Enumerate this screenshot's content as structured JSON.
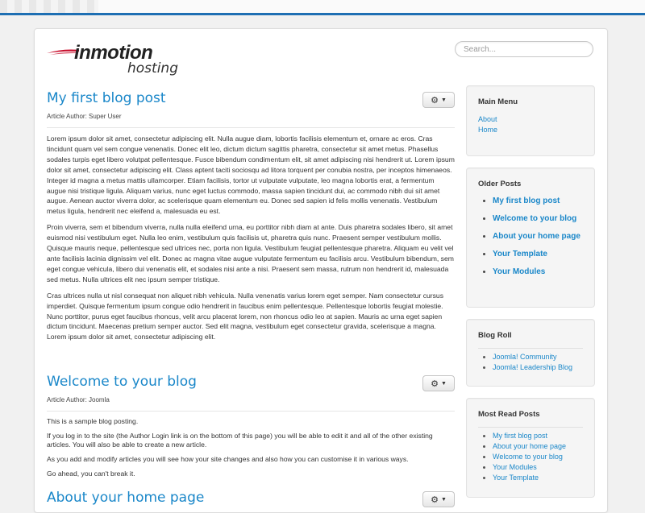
{
  "header": {
    "logo_primary": "inmotion",
    "logo_secondary": "hosting",
    "search_placeholder": "Search..."
  },
  "articles": [
    {
      "title": "My first blog post",
      "author": "Article Author: Super User",
      "paragraphs": [
        "Lorem ipsum dolor sit amet, consectetur adipiscing elit. Nulla augue diam, lobortis facilisis elementum et, ornare ac eros. Cras tincidunt quam vel sem congue venenatis. Donec elit leo, dictum dictum sagittis pharetra, consectetur sit amet metus. Phasellus sodales turpis eget libero volutpat pellentesque. Fusce bibendum condimentum elit, sit amet adipiscing nisi hendrerit ut. Lorem ipsum dolor sit amet, consectetur adipiscing elit. Class aptent taciti sociosqu ad litora torquent per conubia nostra, per inceptos himenaeos. Integer id magna a metus mattis ullamcorper. Etiam facilisis, tortor ut vulputate vulputate, leo magna lobortis erat, a fermentum augue nisi tristique ligula. Aliquam varius, nunc eget luctus commodo, massa sapien tincidunt dui, ac commodo nibh dui sit amet augue. Aenean auctor viverra dolor, ac scelerisque quam elementum eu. Donec sed sapien id felis mollis venenatis. Vestibulum metus ligula, hendrerit nec eleifend a, malesuada eu est.",
        "Proin viverra, sem et bibendum viverra, nulla nulla eleifend urna, eu porttitor nibh diam at ante. Duis pharetra sodales libero, sit amet euismod nisi vestibulum eget. Nulla leo enim, vestibulum quis facilisis ut, pharetra quis nunc. Praesent semper vestibulum mollis. Quisque mauris neque, pellentesque sed ultrices nec, porta non ligula. Vestibulum feugiat pellentesque pharetra. Aliquam eu velit vel ante facilisis lacinia dignissim vel elit. Donec ac magna vitae augue vulputate fermentum eu facilisis arcu. Vestibulum bibendum, sem eget congue vehicula, libero dui venenatis elit, et sodales nisi ante a nisi. Praesent sem massa, rutrum non hendrerit id, malesuada sed metus. Nulla ultrices elit nec ipsum semper tristique.",
        "Cras ultrices nulla ut nisl consequat non aliquet nibh vehicula. Nulla venenatis varius lorem eget semper. Nam consectetur cursus imperdiet. Quisque fermentum ipsum congue odio hendrerit in faucibus enim pellentesque. Pellentesque lobortis feugiat molestie. Nunc porttitor, purus eget faucibus rhoncus, velit arcu placerat lorem, non rhoncus odio leo at sapien. Mauris ac urna eget sapien dictum tincidunt. Maecenas pretium semper auctor. Sed elit magna, vestibulum eget consectetur gravida, scelerisque a magna. Lorem ipsum dolor sit amet, consectetur adipiscing elit."
      ]
    },
    {
      "title": "Welcome to your blog",
      "author": "Article Author: Joomla",
      "paragraphs": [
        "This is a sample blog posting.",
        "If you log in to the site (the Author Login link is on the bottom of this page) you will be able to edit it and all of the other existing articles. You will also be able to create a new article.",
        "As you add and modify articles you will see how your site changes and also how you can customise it in various ways.",
        "Go ahead, you can't break it."
      ]
    },
    {
      "title": "About your home page"
    }
  ],
  "sidebar": {
    "main_menu": {
      "title": "Main Menu",
      "items": [
        "About",
        "Home"
      ]
    },
    "older_posts": {
      "title": "Older Posts",
      "items": [
        "My first blog post",
        "Welcome to your blog",
        "About your home page",
        "Your Template",
        "Your Modules"
      ]
    },
    "blog_roll": {
      "title": "Blog Roll",
      "items": [
        "Joomla! Community",
        "Joomla! Leadership Blog"
      ]
    },
    "most_read": {
      "title": "Most Read Posts",
      "items": [
        "My first blog post",
        "About your home page",
        "Welcome to your blog",
        "Your Modules",
        "Your Template"
      ]
    }
  },
  "colors": {
    "link": "#1a87c9",
    "top_bar": "#1e6fb3"
  },
  "icons": {
    "article_tools": "gear-icon"
  }
}
